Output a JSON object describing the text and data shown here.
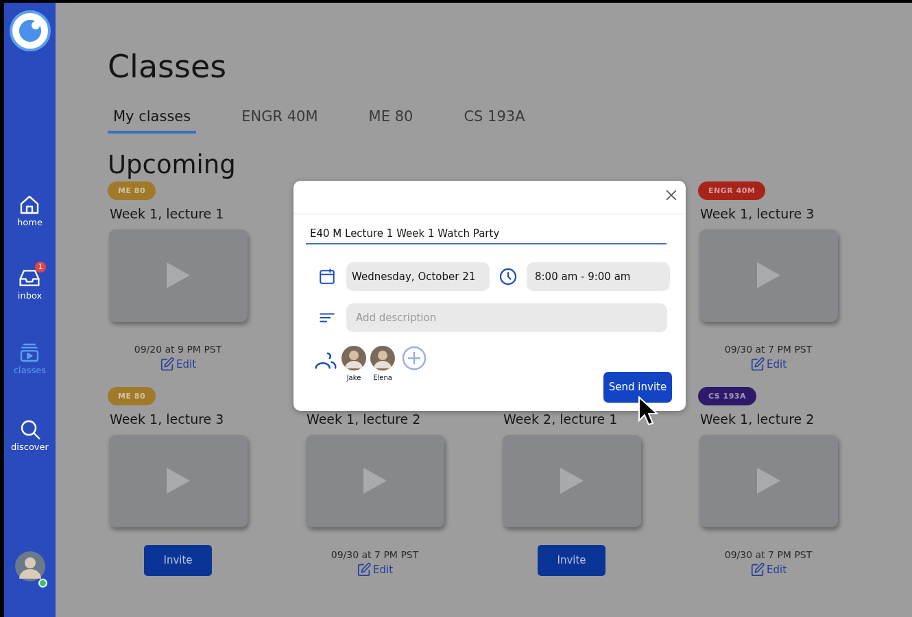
{
  "sidebar": {
    "items": [
      {
        "label": "home",
        "kind": "home",
        "selected": false
      },
      {
        "label": "inbox",
        "kind": "inbox",
        "selected": false,
        "badge": "1"
      },
      {
        "label": "classes",
        "kind": "classes",
        "selected": true
      },
      {
        "label": "discover",
        "kind": "discover",
        "selected": false
      }
    ],
    "user": {
      "online": true
    }
  },
  "page": {
    "title": "Classes"
  },
  "tabs": [
    {
      "label": "My classes",
      "selected": true
    },
    {
      "label": "ENGR 40M",
      "selected": false
    },
    {
      "label": "ME 80",
      "selected": false
    },
    {
      "label": "CS 193A",
      "selected": false
    }
  ],
  "section": {
    "title": "Upcoming"
  },
  "rows": [
    [
      {
        "badge": {
          "label": "ME 80",
          "color": "#a07a2a"
        },
        "title": "Week 1, lecture 1",
        "action": {
          "kind": "edit",
          "date": "09/20 at 9 PM PST",
          "label": "Edit"
        }
      },
      null,
      null,
      {
        "badge": {
          "label": "ENGR 40M",
          "color": "#a8231a"
        },
        "title": "Week 1, lecture 3",
        "action": {
          "kind": "edit",
          "date": "09/30 at 7 PM PST",
          "label": "Edit"
        }
      }
    ],
    [
      {
        "badge": {
          "label": "ME 80",
          "color": "#a07a2a"
        },
        "title": "Week 1, lecture 3",
        "action": {
          "kind": "invite",
          "label": "Invite"
        }
      },
      {
        "title": "Week 1, lecture 2",
        "action": {
          "kind": "edit",
          "date": "09/30 at 7 PM PST",
          "label": "Edit"
        }
      },
      {
        "title": "Week 2, lecture 1",
        "action": {
          "kind": "invite",
          "label": "Invite"
        }
      },
      {
        "badge": {
          "label": "CS 193A",
          "color": "#2e1a6a"
        },
        "title": "Week 1, lecture 2",
        "action": {
          "kind": "edit",
          "date": "09/30 at 7 PM PST",
          "label": "Edit"
        }
      }
    ]
  ],
  "dialog": {
    "event_title": "E40 M Lecture 1 Week 1 Watch Party",
    "date": "Wednesday, October 21",
    "time": "8:00 am - 9:00 am",
    "description": {
      "placeholder": "Add description"
    },
    "invitees": [
      {
        "name": "Jake"
      },
      {
        "name": "Elena"
      }
    ],
    "send_label": "Send invite"
  }
}
